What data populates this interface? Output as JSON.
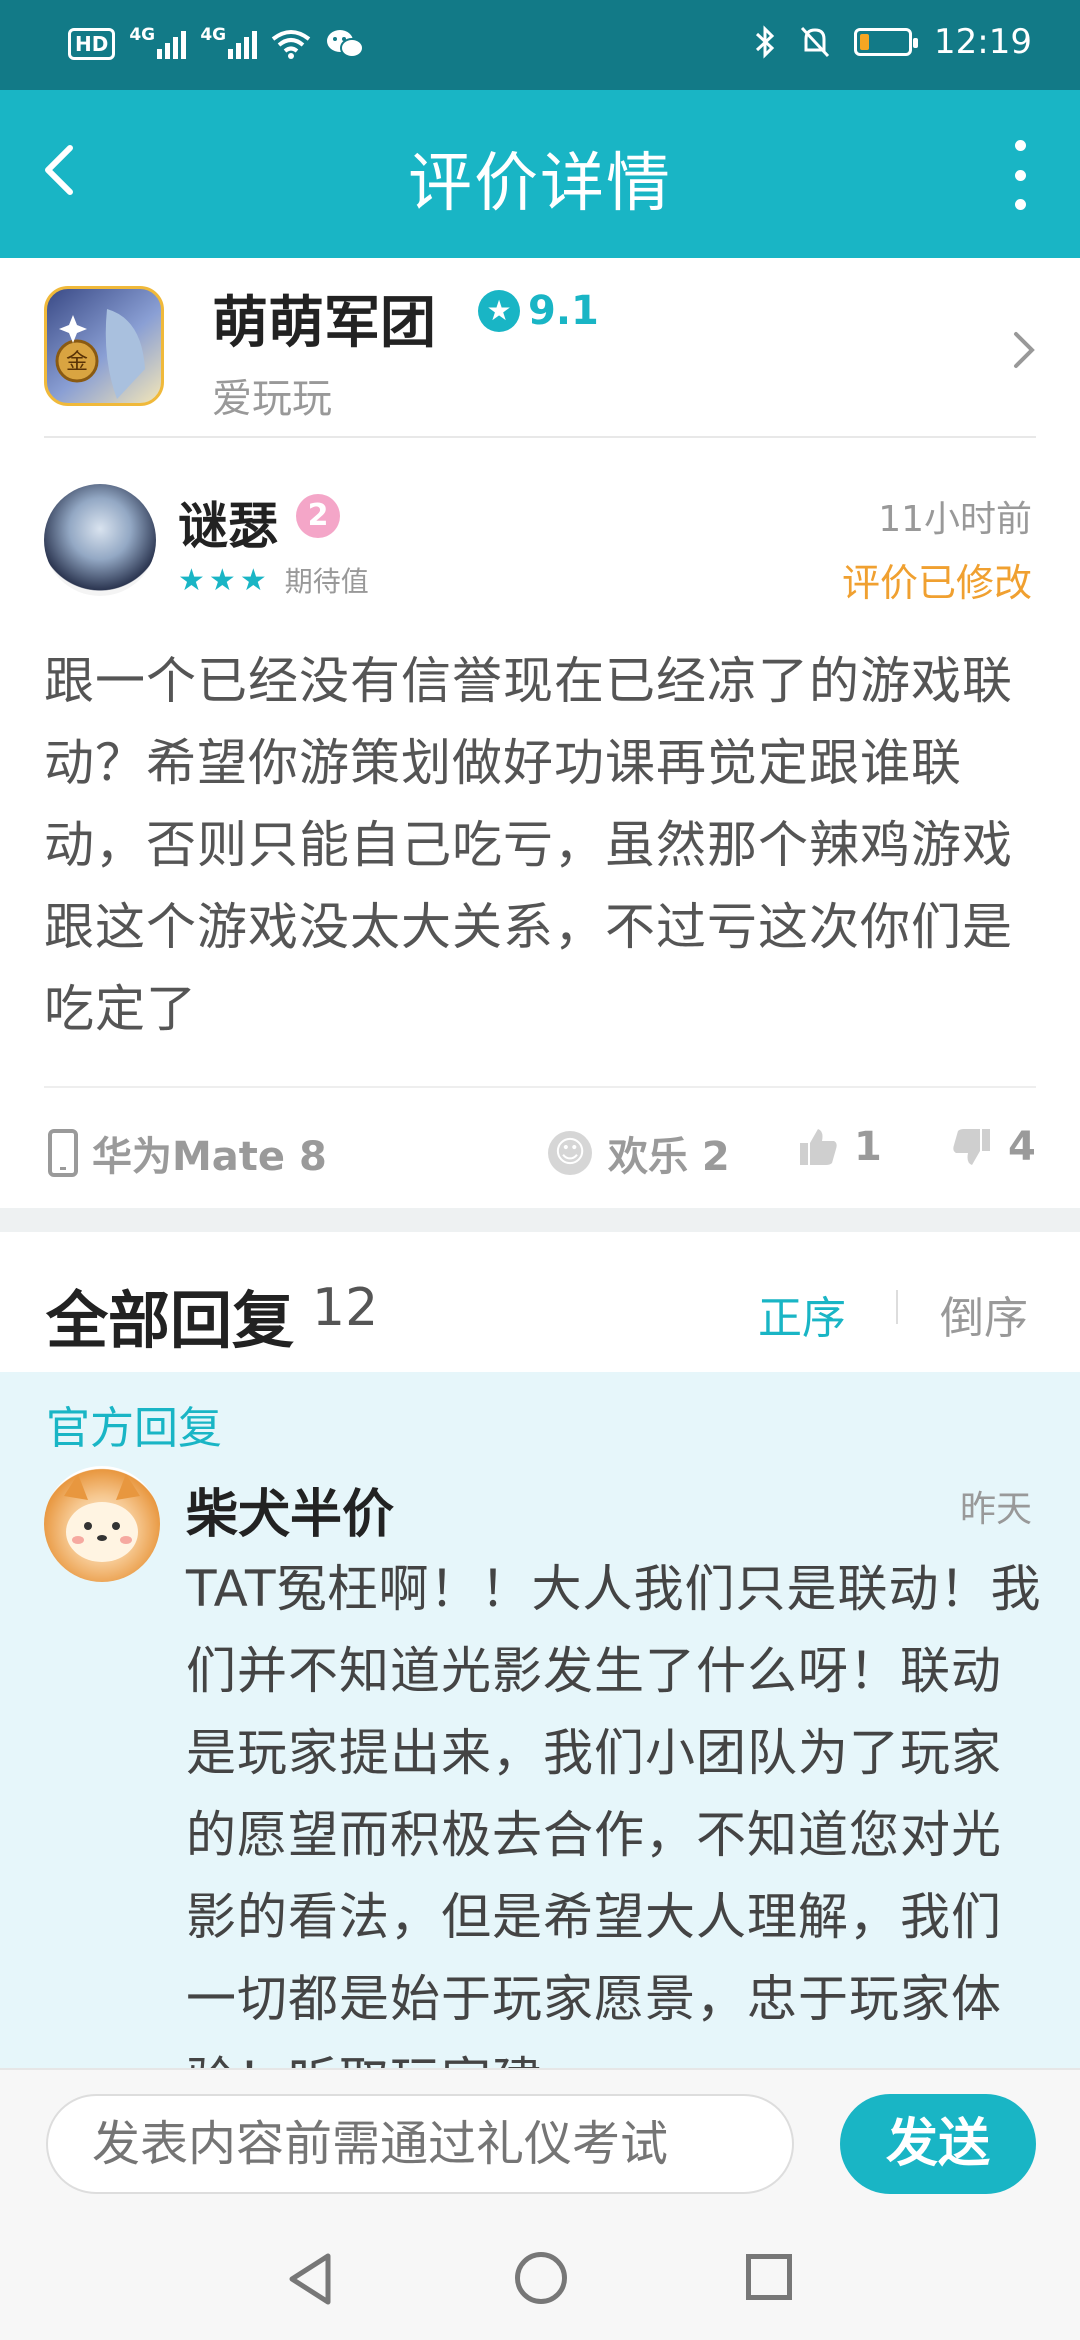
{
  "status_bar": {
    "hd": "HD",
    "net1": "4G",
    "net2": "4G",
    "time": "12:19",
    "battery_level": 0.2,
    "battery_color": "#f5a623"
  },
  "header": {
    "title": "评价详情",
    "back_icon": "chevron-left-icon",
    "more_icon": "more-vertical-icon"
  },
  "game": {
    "name": "萌萌军团",
    "rating": "9.1",
    "developer": "爱玩玩"
  },
  "review": {
    "author": "谜瑟",
    "level": "2",
    "stars": 3,
    "stars_label": "期待值",
    "time": "11小时前",
    "edited": "评价已修改",
    "content": "跟一个已经没有信誉现在已经凉了的游戏联动？希望你游策划做好功课再觉定跟谁联动，否则只能自己吃亏，虽然那个辣鸡游戏跟这个游戏没太大关系，不过亏这次你们是吃定了",
    "device": "华为Mate 8",
    "emotion": "欢乐 2",
    "likes": "1",
    "dislikes": "4"
  },
  "replies": {
    "title": "全部回复",
    "count": "12",
    "sort_asc": "正序",
    "sort_desc": "倒序"
  },
  "official_reply": {
    "label": "官方回复",
    "author": "柴犬半价",
    "time": "昨天",
    "content": "TAT冤枉啊！！大人我们只是联动！我们并不知道光影发生了什么呀！联动是玩家提出来，我们小团队为了玩家的愿望而积极去合作，不知道您对光影的看法，但是希望大人理解，我们一切都是始于玩家愿景，忠于玩家体验！听取玩家建"
  },
  "composer": {
    "placeholder": "发表内容前需通过礼仪考试",
    "send_label": "发送"
  },
  "colors": {
    "accent": "#19b5c5",
    "status_bar": "#127a87",
    "edited": "#f0a030",
    "official_bg": "#e6f6fa"
  }
}
